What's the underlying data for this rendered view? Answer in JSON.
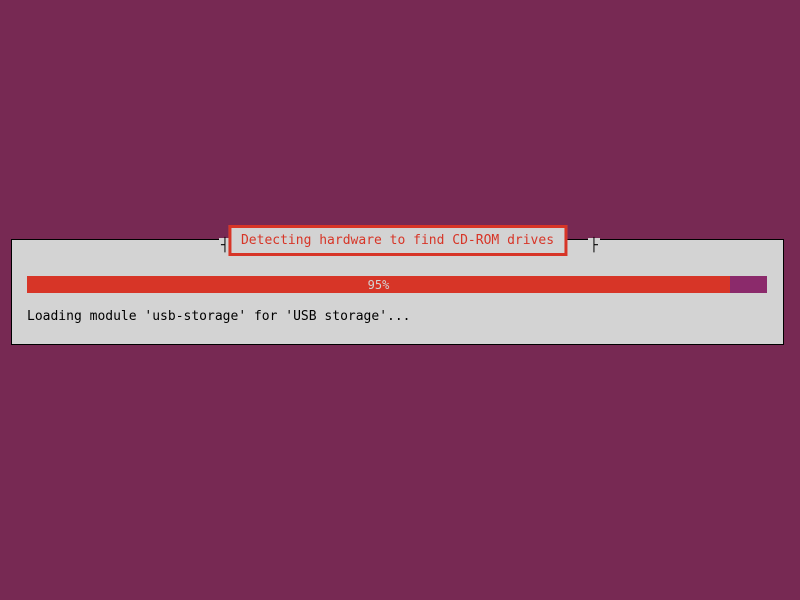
{
  "dialog": {
    "title": "Detecting hardware to find CD-ROM drives",
    "progress_percent_label": "95%",
    "progress_percent_value": 95,
    "status_text": "Loading module 'usb-storage' for 'USB storage'...",
    "colors": {
      "background": "#772953",
      "dialog_bg": "#d3d3d3",
      "accent_red": "#d73527",
      "progress_bg": "#8b2a6b"
    }
  }
}
